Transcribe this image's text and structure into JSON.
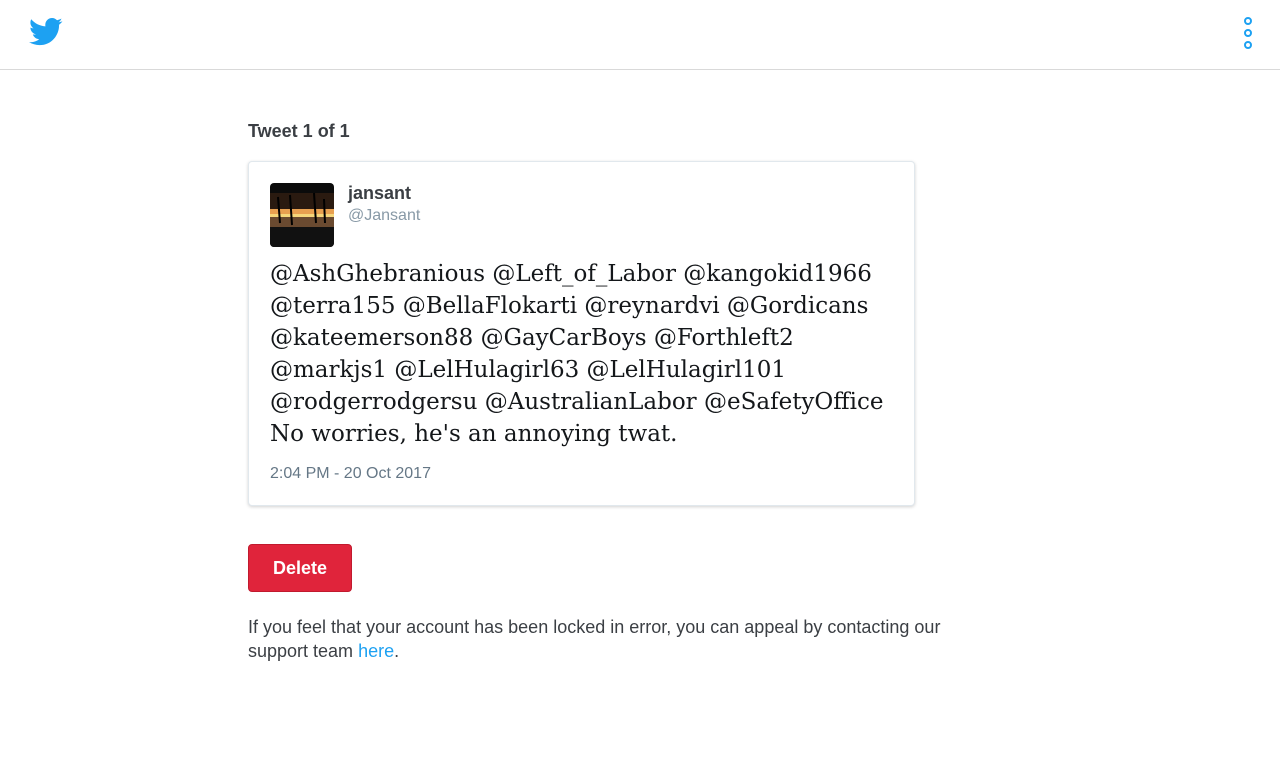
{
  "header": {
    "logo_icon": "twitter-bird-icon",
    "menu_icon": "vertical-dots-icon",
    "accent_color": "#1da1f2"
  },
  "main": {
    "heading": "Tweet 1 of 1",
    "tweet": {
      "author_name": "jansant",
      "author_handle": "@Jansant",
      "text_lines": [
        "@AshGhebranious @Left_of_Labor @kangokid1966",
        "@terra155 @BellaFlokarti @reynardvi @Gordicans",
        "@kateemerson88 @GayCarBoys @Forthleft2",
        "@markjs1 @LelHulagirl63 @LelHulagirl101",
        "@rodgerrodgersu @AustralianLabor @eSafetyOffice",
        "No worries, he's an annoying twat."
      ],
      "timestamp": "2:04 PM - 20 Oct 2017"
    },
    "delete_label": "Delete",
    "delete_color": "#e0243b",
    "appeal": {
      "text_before": "If you feel that your account has been locked in error, you can appeal by contacting our support team ",
      "link_text": "here",
      "text_after": "."
    }
  }
}
